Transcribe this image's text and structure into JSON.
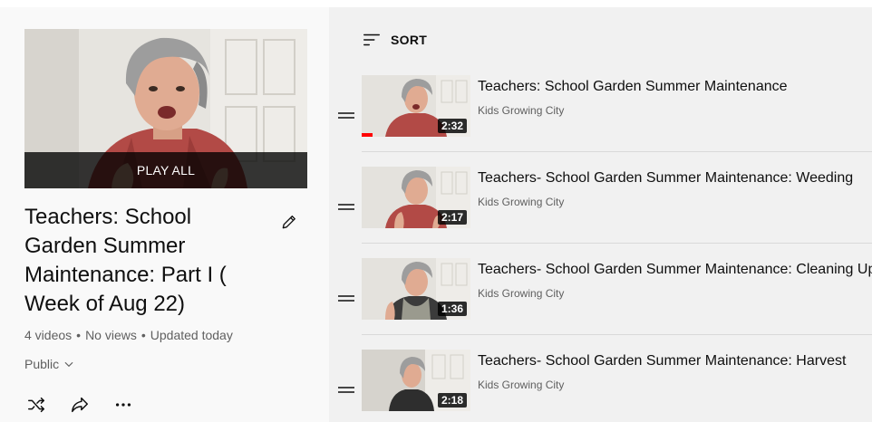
{
  "playlist": {
    "play_all_label": "PLAY ALL",
    "title": "Teachers: School Garden Summer Maintenance: Part I ( Week of Aug 22)",
    "video_count": "4 videos",
    "views": "No views",
    "updated": "Updated today",
    "privacy": "Public",
    "icons": {
      "edit": "pencil-icon",
      "privacy_dropdown": "chevron-down-icon",
      "shuffle": "shuffle-icon",
      "share": "share-icon",
      "more": "more-horizontal-icon"
    }
  },
  "list": {
    "sort_label": "SORT",
    "sort_icon": "sort-icon",
    "items": [
      {
        "title": "Teachers: School Garden Summer Maintenance",
        "channel": "Kids Growing City",
        "duration": "2:32",
        "watched_fraction": 0.1
      },
      {
        "title": "Teachers- School Garden Summer Maintenance: Weeding",
        "channel": "Kids Growing City",
        "duration": "2:17",
        "watched_fraction": 0
      },
      {
        "title": "Teachers- School Garden Summer Maintenance: Cleaning Up",
        "channel": "Kids Growing City",
        "duration": "1:36",
        "watched_fraction": 0
      },
      {
        "title": "Teachers- School Garden Summer Maintenance: Harvest",
        "channel": "Kids Growing City",
        "duration": "2:18",
        "watched_fraction": 0
      }
    ]
  },
  "colors": {
    "accent_red": "#ff0000",
    "text_primary": "#0f0f0f",
    "text_secondary": "#606060",
    "list_background": "#f1f1f1"
  }
}
